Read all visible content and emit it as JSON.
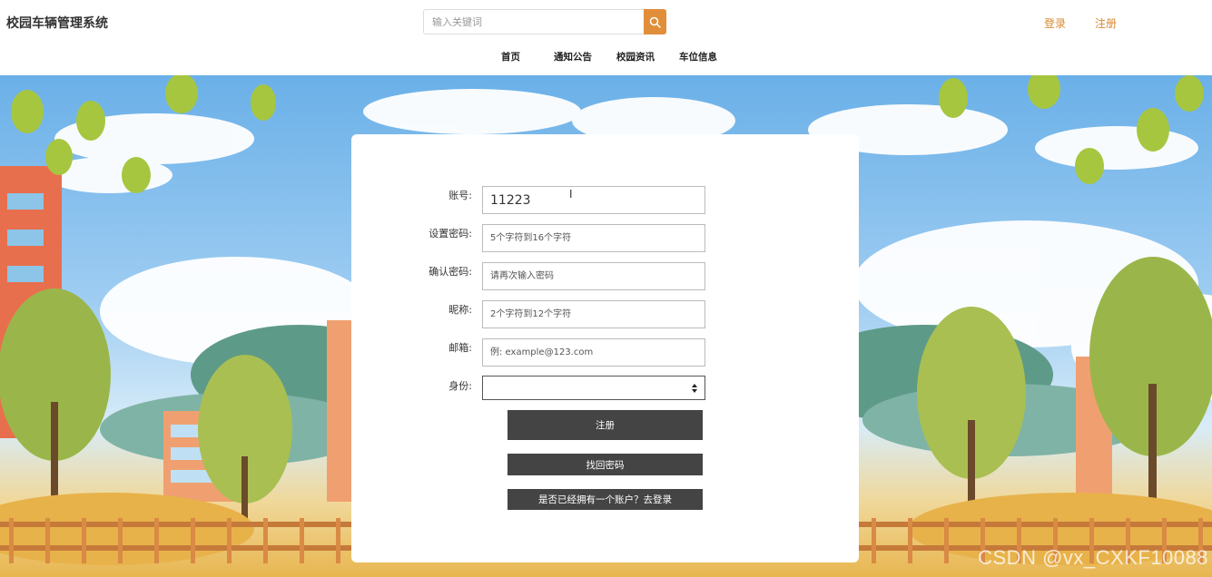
{
  "header": {
    "site_title": "校园车辆管理系统",
    "search_placeholder": "输入关键词",
    "login_label": "登录",
    "register_label": "注册"
  },
  "nav": {
    "items": [
      "首页",
      "通知公告",
      "校园资讯",
      "车位信息"
    ]
  },
  "form": {
    "account_label": "账号:",
    "account_value": "11223",
    "password_label": "设置密码:",
    "password_placeholder": "5个字符到16个字符",
    "confirm_label": "确认密码:",
    "confirm_placeholder": "请再次输入密码",
    "nickname_label": "昵称:",
    "nickname_placeholder": "2个字符到12个字符",
    "email_label": "邮箱:",
    "email_placeholder": "例: example@123.com",
    "role_label": "身份:",
    "role_value": ""
  },
  "buttons": {
    "register": "注册",
    "forgot": "找回密码",
    "goto_login": "是否已经拥有一个账户？去登录"
  },
  "watermark": "CSDN @vx_CXKF10088",
  "colors": {
    "accent": "#e08e3a",
    "button_bg": "#444444"
  }
}
